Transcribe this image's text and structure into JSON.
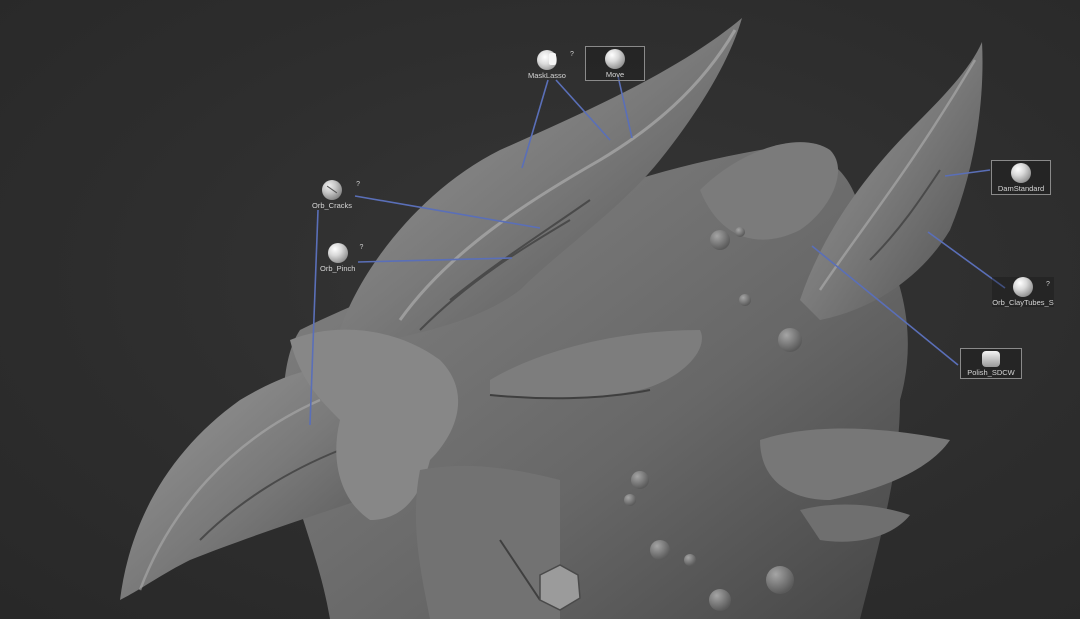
{
  "brushes": {
    "mask_lasso": {
      "label": "MaskLasso",
      "help": "?"
    },
    "move": {
      "label": "Move"
    },
    "orb_cracks": {
      "label": "Orb_Cracks",
      "help": "?"
    },
    "orb_pinch": {
      "label": "Orb_Pinch",
      "help": "?"
    },
    "dam_standard": {
      "label": "DamStandard"
    },
    "orb_claytubes": {
      "label": "Orb_ClayTubes_S",
      "help": "?"
    },
    "polish": {
      "label": "Polish_SDCW"
    }
  },
  "colors": {
    "background": "#2f2f2f",
    "leader_line": "#5a6fb8",
    "sculpt_base": "#6e6e6e"
  }
}
